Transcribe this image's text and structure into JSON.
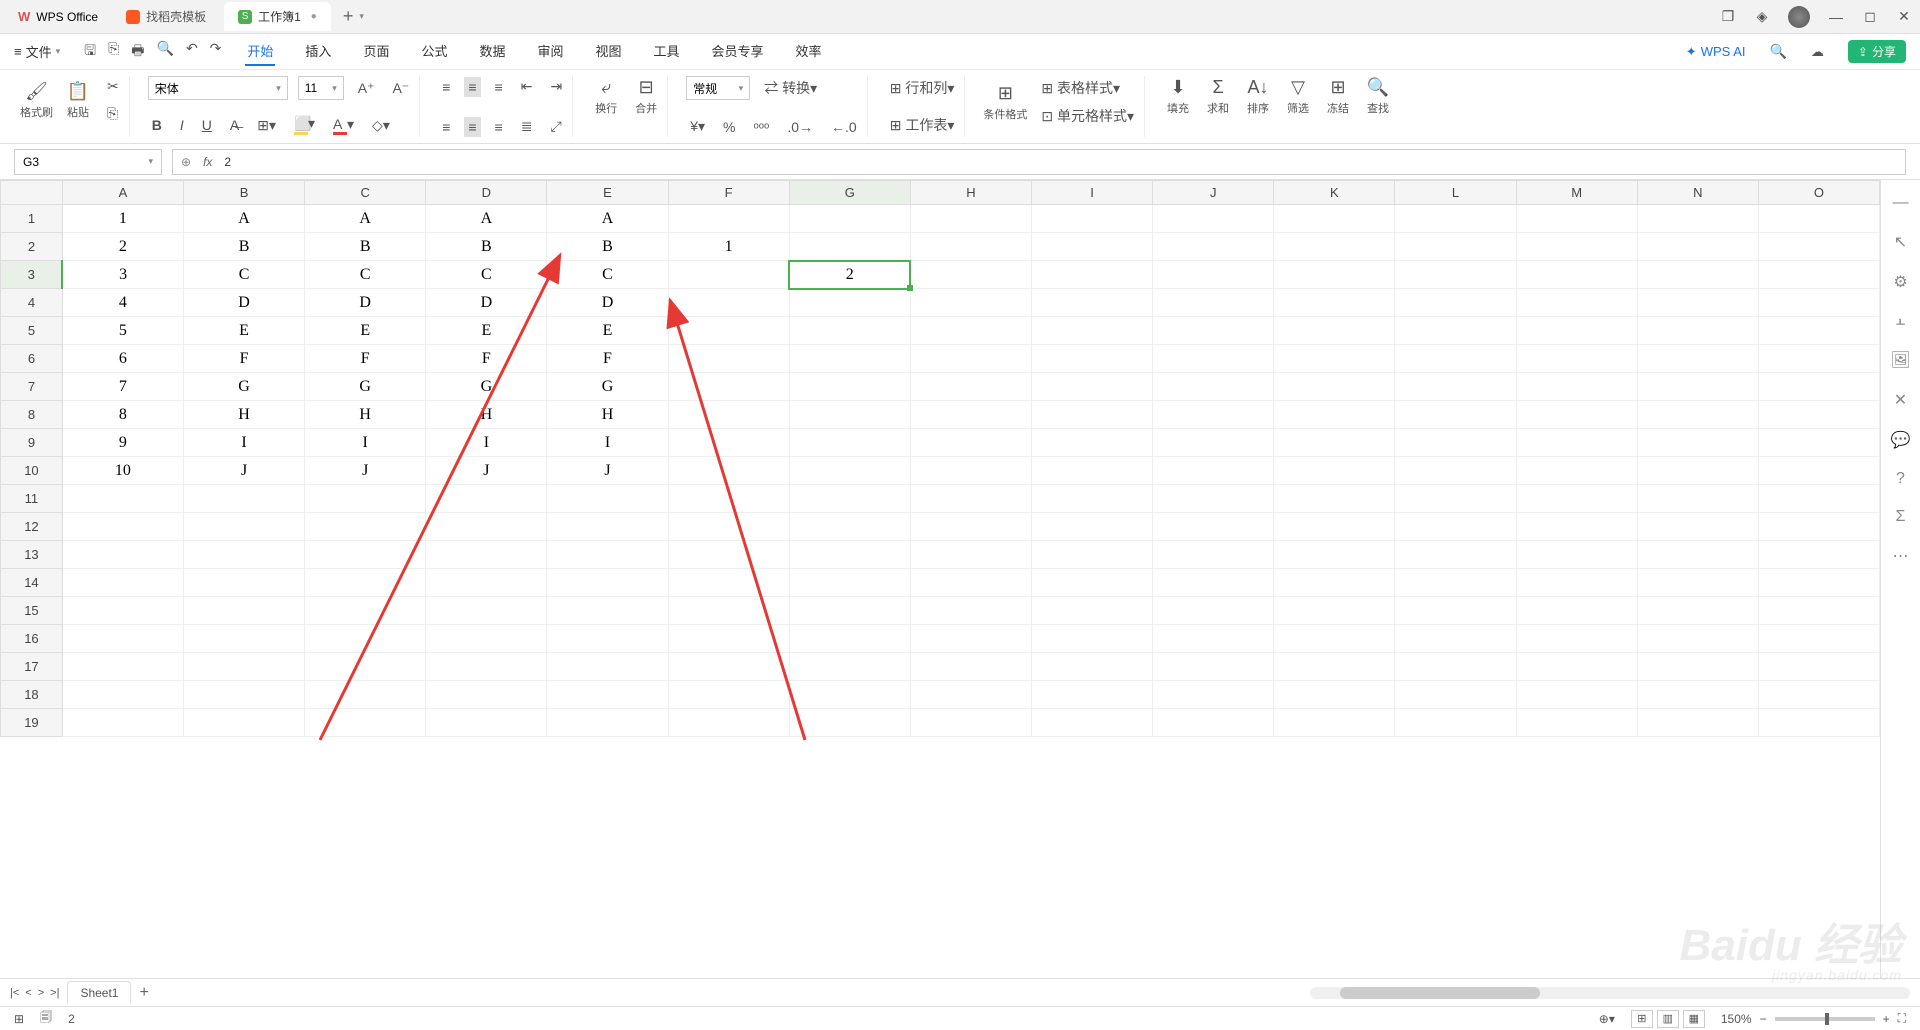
{
  "titlebar": {
    "app_name": "WPS Office",
    "tabs": [
      {
        "label": "找稻壳模板",
        "icon": "orange"
      },
      {
        "label": "工作簿1",
        "icon": "green",
        "modified": true,
        "active": true
      }
    ]
  },
  "menubar": {
    "file_label": "文件",
    "items": [
      "开始",
      "插入",
      "页面",
      "公式",
      "数据",
      "审阅",
      "视图",
      "工具",
      "会员专享",
      "效率"
    ],
    "active_index": 0,
    "ai_label": "WPS AI",
    "share_label": "分享"
  },
  "ribbon": {
    "format_painter": "格式刷",
    "paste": "粘贴",
    "font_name": "宋体",
    "font_size": "11",
    "wrap": "换行",
    "merge": "合并",
    "number_format": "常规",
    "convert": "转换",
    "row_col": "行和列",
    "worksheet": "工作表",
    "cond_fmt": "条件格式",
    "table_style": "表格样式",
    "cell_style": "单元格样式",
    "fill": "填充",
    "sum": "求和",
    "sort": "排序",
    "filter": "筛选",
    "freeze": "冻结",
    "find": "查找"
  },
  "formula_bar": {
    "name_box": "G3",
    "fx": "fx",
    "formula": "2"
  },
  "grid": {
    "columns": [
      "A",
      "B",
      "C",
      "D",
      "E",
      "F",
      "G",
      "H",
      "I",
      "J",
      "K",
      "L",
      "M",
      "N",
      "O"
    ],
    "row_count": 19,
    "active_cell": {
      "col": "G",
      "row": 3
    },
    "data": {
      "A": [
        "1",
        "2",
        "3",
        "4",
        "5",
        "6",
        "7",
        "8",
        "9",
        "10"
      ],
      "B": [
        "A",
        "B",
        "C",
        "D",
        "E",
        "F",
        "G",
        "H",
        "I",
        "J"
      ],
      "C": [
        "A",
        "B",
        "C",
        "D",
        "E",
        "F",
        "G",
        "H",
        "I",
        "J"
      ],
      "D": [
        "A",
        "B",
        "C",
        "D",
        "E",
        "F",
        "G",
        "H",
        "I",
        "J"
      ],
      "E": [
        "A",
        "B",
        "C",
        "D",
        "E",
        "F",
        "G",
        "H",
        "I",
        "J"
      ],
      "F": [
        "",
        "1"
      ],
      "G": [
        "",
        "",
        "2"
      ]
    }
  },
  "sheet_tabs": {
    "active": "Sheet1"
  },
  "statusbar": {
    "value": "2",
    "zoom": "150%"
  },
  "watermark": {
    "main": "Baidu 经验",
    "sub": "jingyan.baidu.com"
  }
}
